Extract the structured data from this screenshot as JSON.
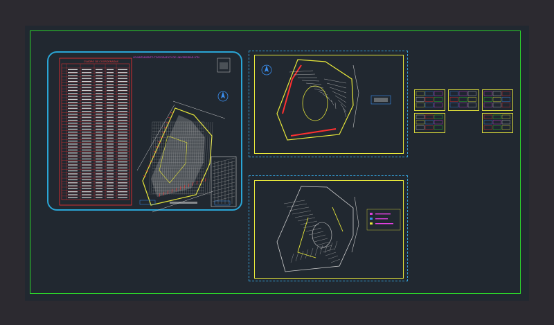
{
  "colors": {
    "background": "#2c2a30",
    "model_space": "#212830",
    "border_green": "#2bd62b",
    "sheet_cyan": "#2aa6d6",
    "frame_yellow": "#e8e83a",
    "table_red": "#ff3030",
    "magenta": "#e040e0",
    "drawing_grey": "#c8c8c8",
    "blue": "#3b8ff0"
  },
  "main_sheet": {
    "title": "LEVANTAMIENTO TOPOGRAFICO DE UNIVERSIDAD UTN",
    "table_header": "CUADRO DE COORDENADAS"
  },
  "icons": [
    "north-arrow-icon",
    "north-arrow-icon",
    "north-arrow-icon"
  ]
}
